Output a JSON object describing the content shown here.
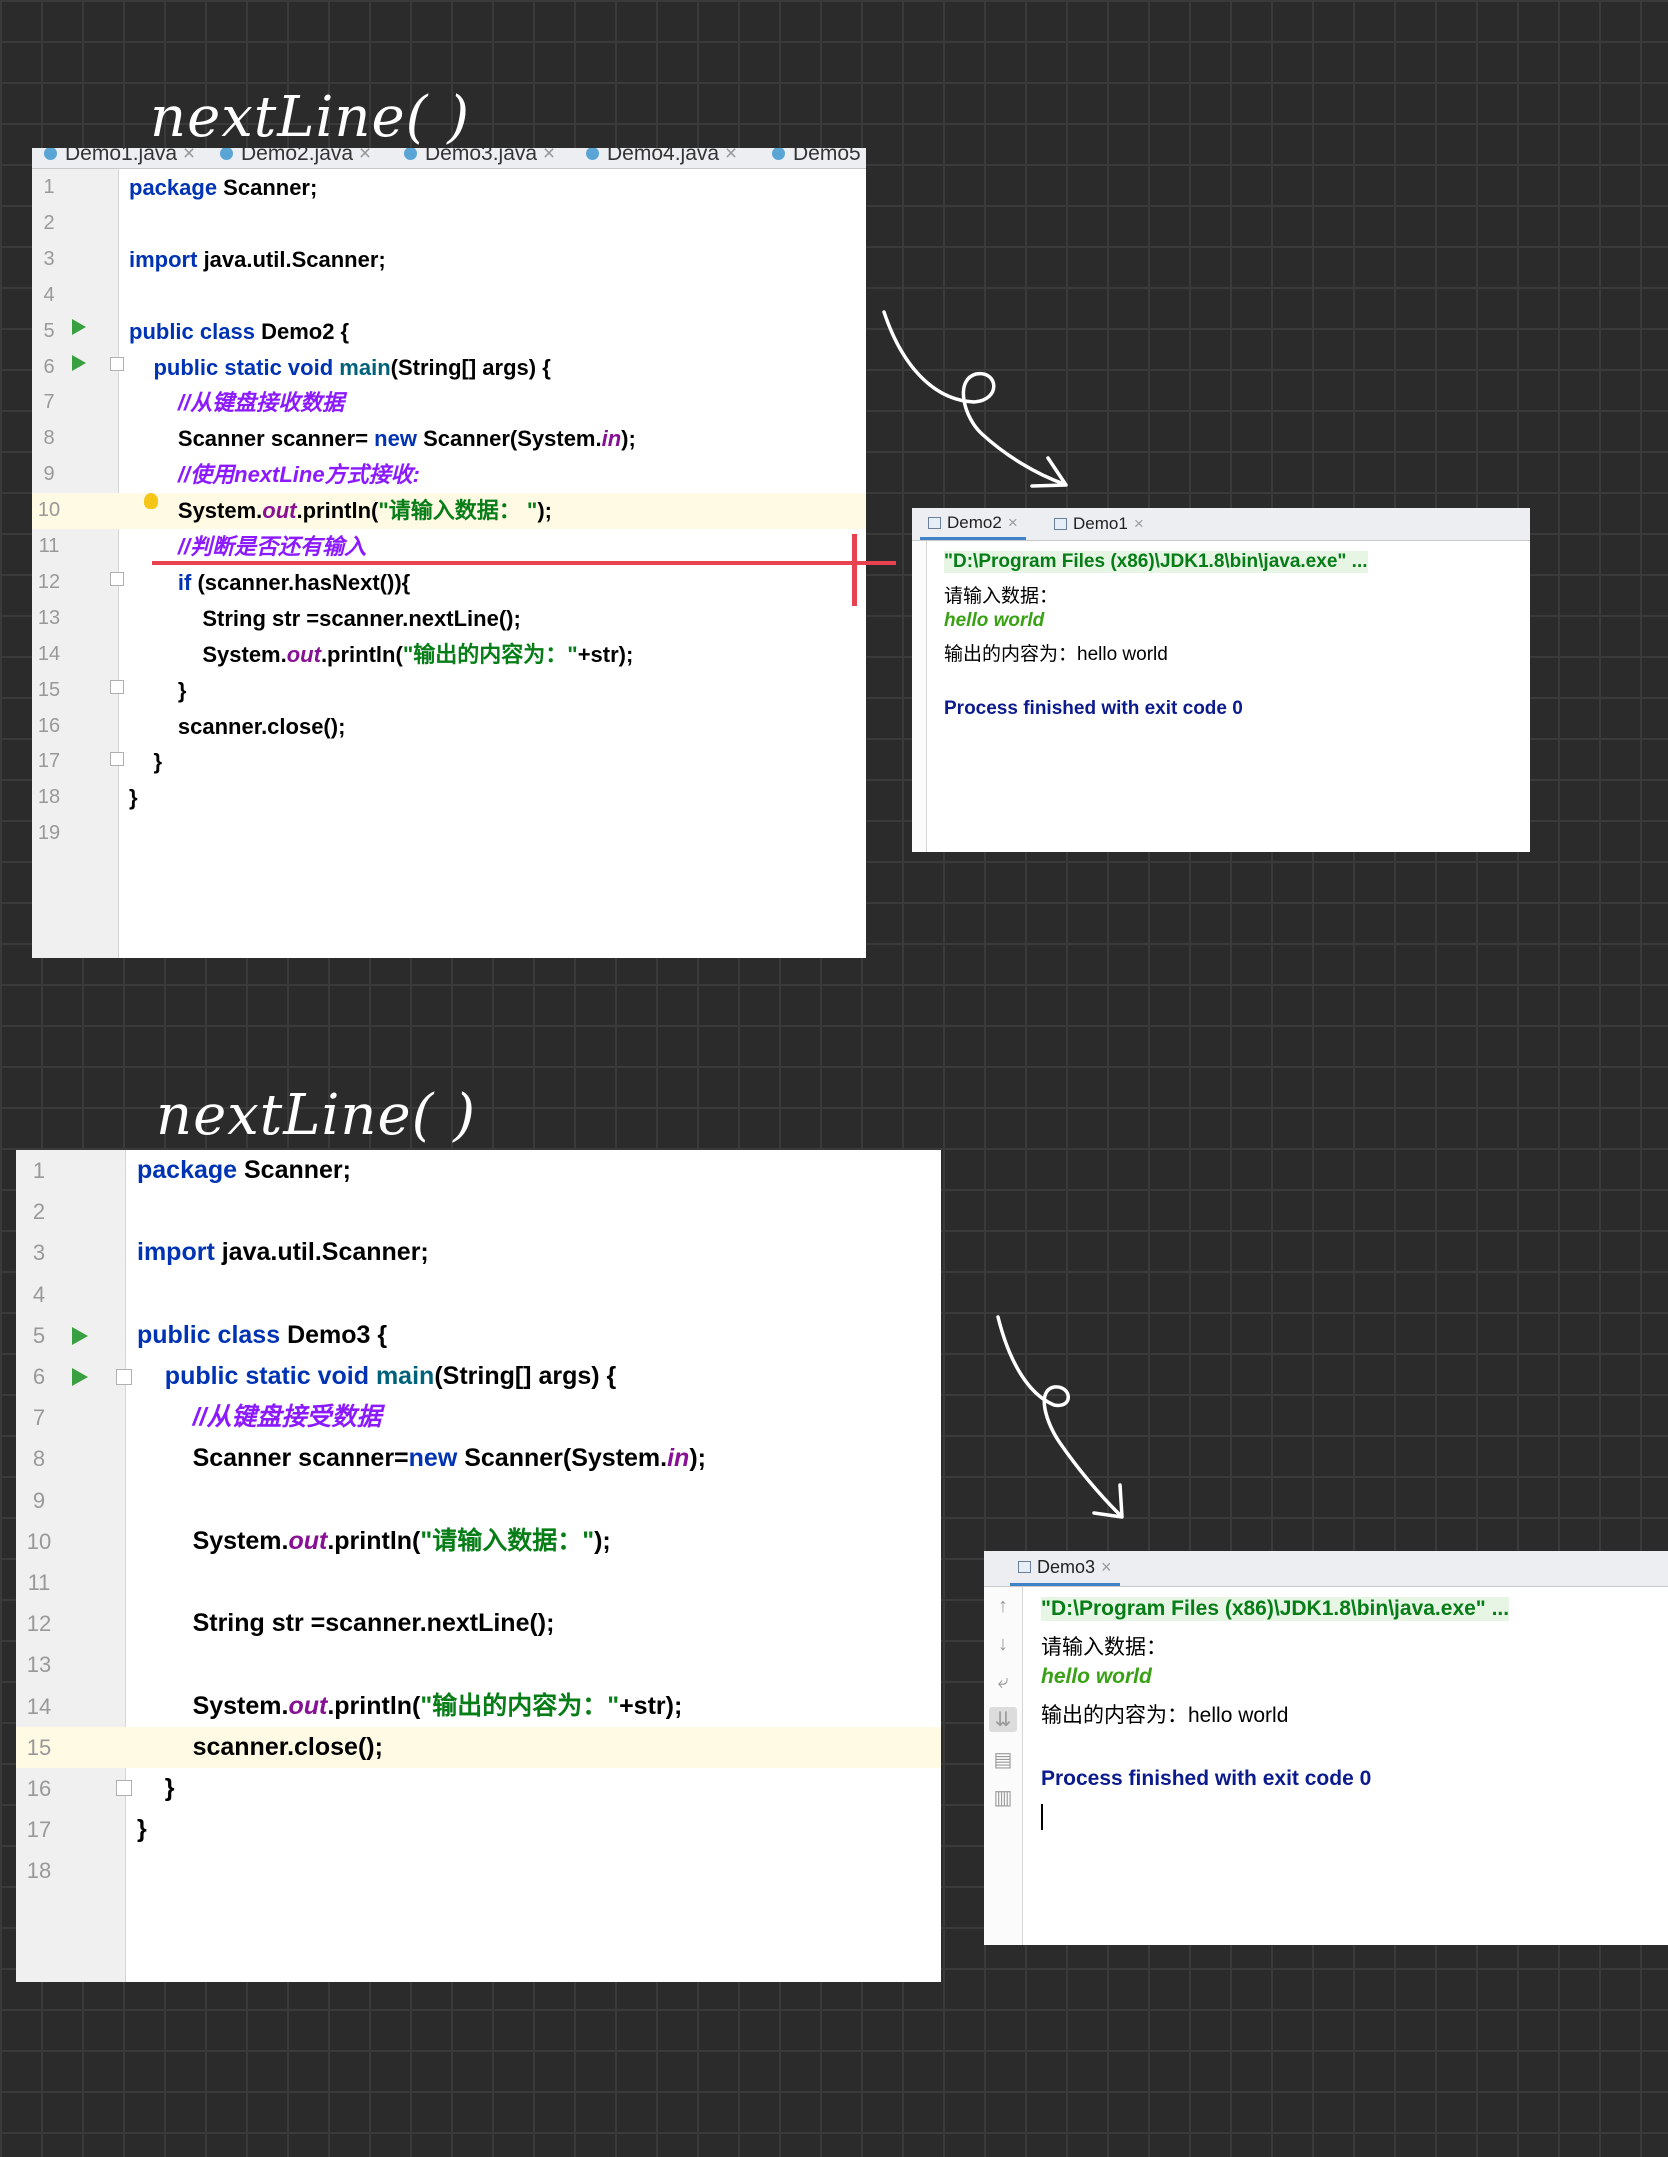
{
  "labels": {
    "top": "nextLine( )",
    "bottom": "nextLine( )"
  },
  "colors": {
    "accent": "#e8414f",
    "keyword": "#0033b3",
    "string": "#067d17",
    "comment": "#8c1aff",
    "field": "#871094",
    "run_icon": "#39a041"
  },
  "icons": {
    "run": "play-triangle-icon",
    "fold": "fold-marker-icon",
    "bulb": "lightbulb-icon",
    "file": "java-file-icon",
    "close": "close-icon"
  },
  "editor1": {
    "tabs": [
      "Demo1.java",
      "Demo2.java",
      "Demo3.java",
      "Demo4.java",
      "Demo5"
    ],
    "lines": [
      "<span class='kw'>package</span> Scanner;",
      "",
      "<span class='kw'>import</span> java.util.Scanner;",
      "",
      "<span class='kw'>public class</span> Demo2 {",
      "&nbsp;&nbsp;&nbsp;&nbsp;<span class='kw'>public static void</span> <span class='fn'>main</span>(String[] args) {",
      "&nbsp;&nbsp;&nbsp;&nbsp;&nbsp;&nbsp;&nbsp;&nbsp;<span class='cm'>//从键盘接收数据</span>",
      "&nbsp;&nbsp;&nbsp;&nbsp;&nbsp;&nbsp;&nbsp;&nbsp;Scanner scanner= <span class='kw'>new</span> Scanner(System.<span class='fld'>in</span>);",
      "&nbsp;&nbsp;&nbsp;&nbsp;&nbsp;&nbsp;&nbsp;&nbsp;<span class='cm'>//使用nextLine方式接收:</span>",
      "&nbsp;&nbsp;&nbsp;&nbsp;&nbsp;&nbsp;&nbsp;&nbsp;System.<span class='fld'>out</span>.println(<span class='st'>\"请输入数据： \"</span>);",
      "&nbsp;&nbsp;&nbsp;&nbsp;&nbsp;&nbsp;&nbsp;&nbsp;<span class='cm'>//判断是否还有输入</span>",
      "&nbsp;&nbsp;&nbsp;&nbsp;&nbsp;&nbsp;&nbsp;&nbsp;<span class='kw'>if</span> (scanner.hasNext()){",
      "&nbsp;&nbsp;&nbsp;&nbsp;&nbsp;&nbsp;&nbsp;&nbsp;&nbsp;&nbsp;&nbsp;&nbsp;String str =scanner.nextLine();",
      "&nbsp;&nbsp;&nbsp;&nbsp;&nbsp;&nbsp;&nbsp;&nbsp;&nbsp;&nbsp;&nbsp;&nbsp;System.<span class='fld'>out</span>.println(<span class='st'>\"输出的内容为：\"</span>+str);",
      "&nbsp;&nbsp;&nbsp;&nbsp;&nbsp;&nbsp;&nbsp;&nbsp;}",
      "&nbsp;&nbsp;&nbsp;&nbsp;&nbsp;&nbsp;&nbsp;&nbsp;scanner.close();",
      "&nbsp;&nbsp;&nbsp;&nbsp;}",
      "}",
      ""
    ]
  },
  "console1": {
    "tabs": [
      "Demo2",
      "Demo1"
    ],
    "command": "\"D:\\Program Files (x86)\\JDK1.8\\bin\\java.exe\" ...",
    "prompt": "请输入数据：",
    "input": "hello world",
    "result": "输出的内容为：hello world",
    "finished": "Process finished with exit code 0"
  },
  "editor2": {
    "lines": [
      "<span class='kw'>package</span> Scanner;",
      "",
      "<span class='kw'>import</span> java.util.Scanner;",
      "",
      "<span class='kw'>public class</span> Demo3 {",
      "&nbsp;&nbsp;&nbsp;&nbsp;<span class='kw'>public static void</span> <span class='fn'>main</span>(String[] args) {",
      "&nbsp;&nbsp;&nbsp;&nbsp;&nbsp;&nbsp;&nbsp;&nbsp;<span class='cm'>//从键盘接受数据</span>",
      "&nbsp;&nbsp;&nbsp;&nbsp;&nbsp;&nbsp;&nbsp;&nbsp;Scanner scanner=<span class='kw'>new</span> Scanner(System.<span class='fld'>in</span>);",
      "",
      "&nbsp;&nbsp;&nbsp;&nbsp;&nbsp;&nbsp;&nbsp;&nbsp;System.<span class='fld'>out</span>.println(<span class='st'>\"请输入数据：\"</span>);",
      "",
      "&nbsp;&nbsp;&nbsp;&nbsp;&nbsp;&nbsp;&nbsp;&nbsp;String str =scanner.nextLine();",
      "",
      "&nbsp;&nbsp;&nbsp;&nbsp;&nbsp;&nbsp;&nbsp;&nbsp;System.<span class='fld'>out</span>.println(<span class='st'>\"输出的内容为：\"</span>+str);",
      "&nbsp;&nbsp;&nbsp;&nbsp;&nbsp;&nbsp;&nbsp;&nbsp;scanner.close();",
      "&nbsp;&nbsp;&nbsp;&nbsp;}",
      "}",
      ""
    ]
  },
  "console2": {
    "tabs": [
      "Demo3"
    ],
    "command": "\"D:\\Program Files (x86)\\JDK1.8\\bin\\java.exe\" ...",
    "prompt": "请输入数据：",
    "input": "hello world",
    "result": "输出的内容为：hello world",
    "finished": "Process finished with exit code 0"
  }
}
